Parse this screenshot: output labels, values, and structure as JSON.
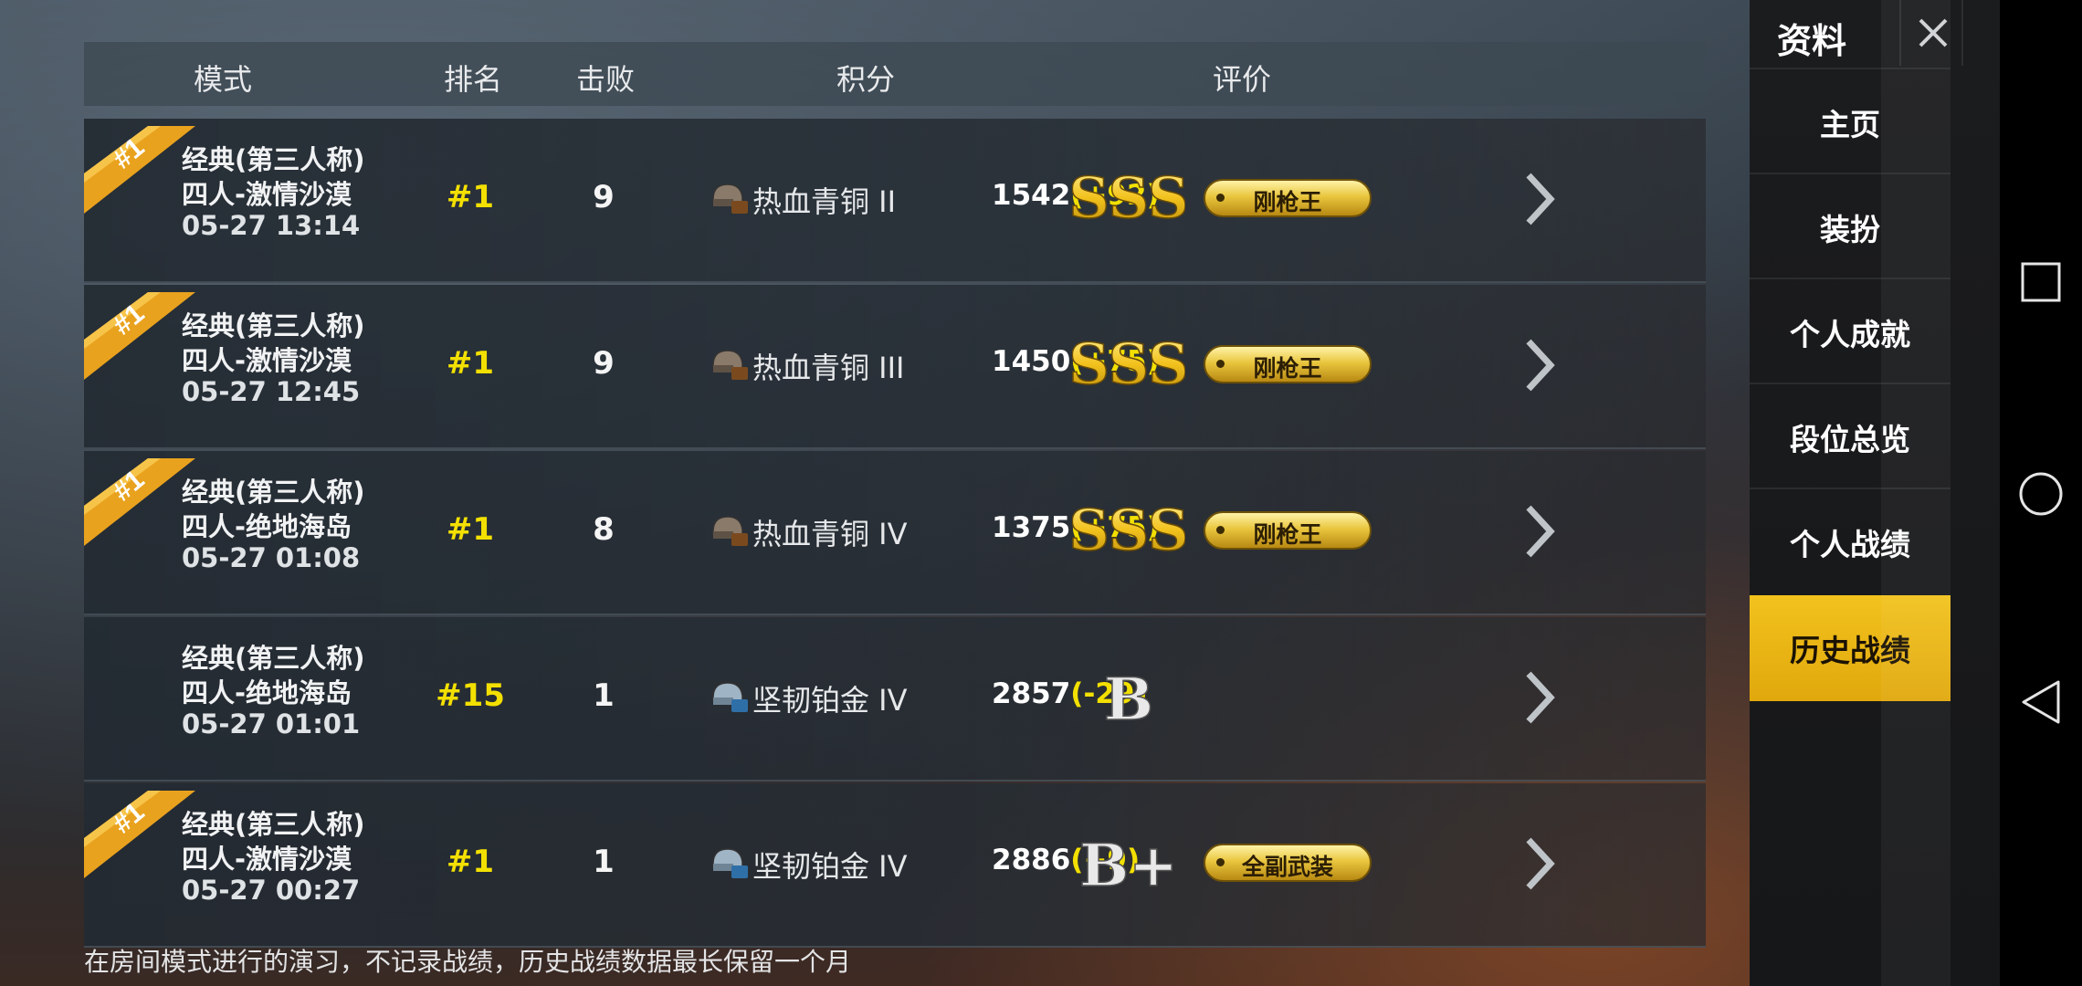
{
  "header": {
    "mode": "模式",
    "rank": "排名",
    "kills": "击败",
    "score": "积分",
    "rating": "评价"
  },
  "records": [
    {
      "first_place": true,
      "ribbon_text": "#1",
      "mode": "经典(第三人称)",
      "map": "四人-激情沙漠",
      "time": "05-27 13:14",
      "rank": "#1",
      "kills": "9",
      "tier": "热血青铜 II",
      "tier_icon": "bronze-helmet-icon",
      "score": "1542",
      "delta": "(+92)",
      "grade": "SSS",
      "badge": "刚枪王"
    },
    {
      "first_place": true,
      "ribbon_text": "#1",
      "mode": "经典(第三人称)",
      "map": "四人-激情沙漠",
      "time": "05-27 12:45",
      "rank": "#1",
      "kills": "9",
      "tier": "热血青铜 III",
      "tier_icon": "bronze-helmet-icon",
      "score": "1450",
      "delta": "(+75)",
      "grade": "SSS",
      "badge": "刚枪王"
    },
    {
      "first_place": true,
      "ribbon_text": "#1",
      "mode": "经典(第三人称)",
      "map": "四人-绝地海岛",
      "time": "05-27 01:08",
      "rank": "#1",
      "kills": "8",
      "tier": "热血青铜 IV",
      "tier_icon": "bronze-helmet-icon",
      "score": "1375",
      "delta": "(+75)",
      "grade": "SSS",
      "badge": "刚枪王"
    },
    {
      "first_place": false,
      "ribbon_text": "",
      "mode": "经典(第三人称)",
      "map": "四人-绝地海岛",
      "time": "05-27 01:01",
      "rank": "#15",
      "kills": "1",
      "tier": "坚韧铂金 IV",
      "tier_icon": "platinum-helmet-icon",
      "score": "2857",
      "delta": "(-29)",
      "grade": "B",
      "badge": ""
    },
    {
      "first_place": true,
      "ribbon_text": "#1",
      "mode": "经典(第三人称)",
      "map": "四人-激情沙漠",
      "time": "05-27 00:27",
      "rank": "#1",
      "kills": "1",
      "tier": "坚韧铂金 IV",
      "tier_icon": "platinum-helmet-icon",
      "score": "2886",
      "delta": "(+9)",
      "grade": "B+",
      "badge": "全副武装"
    }
  ],
  "footer": {
    "note": "在房间模式进行的演习，不记录战绩，历史战绩数据最长保留一个月"
  },
  "sidebar": {
    "title": "资料",
    "items": [
      "主页",
      "装扮",
      "个人成就",
      "段位总览",
      "个人战绩",
      "历史战绩"
    ],
    "active_index": 5
  },
  "colors": {
    "accent_yellow": "#f3e000",
    "active_tab": "#e9b514"
  }
}
